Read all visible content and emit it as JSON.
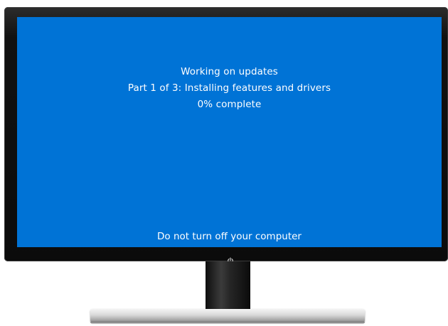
{
  "screen": {
    "background_color": "#0073d6",
    "title": "Working on updates",
    "step": "Part 1 of 3: Installing features and drivers",
    "progress": "0% complete",
    "progress_percent": 0,
    "warning": "Do not turn off your computer"
  },
  "monitor": {
    "power_icon": "power-icon"
  }
}
